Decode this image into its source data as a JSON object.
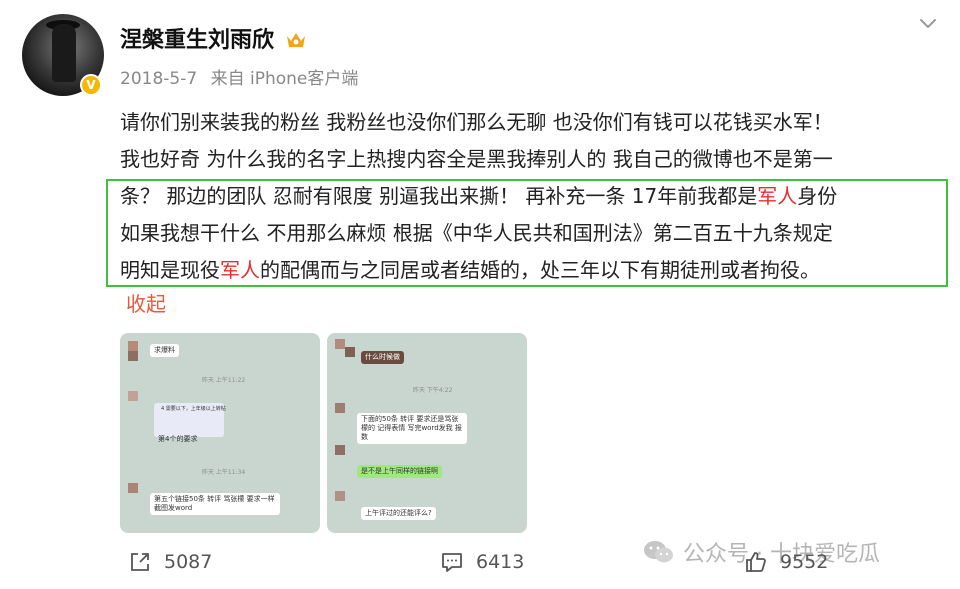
{
  "user": {
    "name": "涅槃重生刘雨欣",
    "date": "2018-5-7",
    "source": "来自 iPhone客户端",
    "verified_badge": "V"
  },
  "post": {
    "lines": [
      [
        {
          "t": "请你们别来装我的粉丝 我粉丝也没你们那么无聊 也没你们有钱可以花钱买水军！",
          "hl": false
        }
      ],
      [
        {
          "t": "我也好奇 为什么我的名字上热搜内容全是黑我捧别人的 我自己的微博也不是第一",
          "hl": false
        }
      ],
      [
        {
          "t": "条？ 那边的团队 忍耐有限度 别逼我出来撕！  再补充一条 17年前我都是",
          "hl": false
        },
        {
          "t": "军人",
          "hl": true
        },
        {
          "t": "身份",
          "hl": false
        }
      ],
      [
        {
          "t": "如果我想干什么 不用那么麻烦   根据《中华人民共和国刑法》第二百五十九条规定",
          "hl": false
        }
      ],
      [
        {
          "t": "明知是现役",
          "hl": false
        },
        {
          "t": "军人",
          "hl": true
        },
        {
          "t": "的配偶而与之同居或者结婚的，处三年以下有期徒刑或者拘役。",
          "hl": false
        }
      ]
    ],
    "collapse_label": "收起"
  },
  "images": {
    "img1": {
      "bubble_top": "求爆料",
      "time1": "昨天 上午11:22",
      "quote": "4  需要以下，上年级以上转帖",
      "req": "第4个的要求",
      "time2": "昨天 上午11:34",
      "msg": "第五个链接50条 转评 骂张檬 要求一样   截图发word"
    },
    "img2": {
      "bubble_top": "什么时候做",
      "time1": "昨天 下午4:22",
      "msg1": "下面的50条 转评 要求还是骂张檬的 记得表情 写完word发我 报数",
      "msg2": "是不是上午同样的链接啊",
      "msg3": "上午评过的还能评么?"
    }
  },
  "actions": {
    "repost_count": "5087",
    "comment_count": "6413",
    "like_count": "9552"
  },
  "watermark": {
    "text": "公众号 · 十块爱吃瓜"
  },
  "colors": {
    "highlight": "#e62e2e",
    "box": "#3ec23e",
    "collapse": "#e8583a",
    "meta": "#888888"
  }
}
